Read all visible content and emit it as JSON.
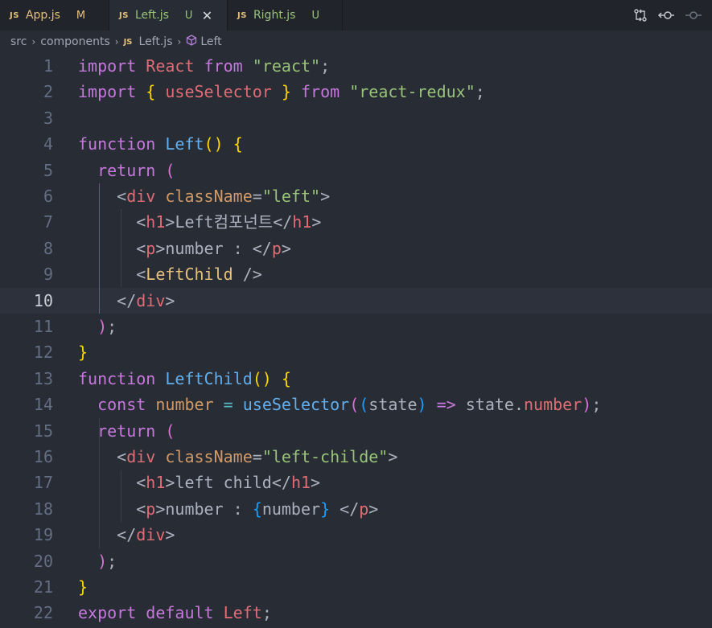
{
  "tabs": [
    {
      "icon": "JS",
      "name": "App.js",
      "status": "M"
    },
    {
      "icon": "JS",
      "name": "Left.js",
      "status": "U",
      "close": "✕"
    },
    {
      "icon": "JS",
      "name": "Right.js",
      "status": "U"
    }
  ],
  "breadcrumb": {
    "src": "src",
    "components": "components",
    "file_icon": "JS",
    "file": "Left.js",
    "symbol": "Left",
    "sep": "›"
  },
  "editor": {
    "current_line": 10,
    "line_numbers": [
      "1",
      "2",
      "3",
      "4",
      "5",
      "6",
      "7",
      "8",
      "9",
      "10",
      "11",
      "12",
      "13",
      "14",
      "15",
      "16",
      "17",
      "18",
      "19",
      "20",
      "21",
      "22"
    ],
    "lines": [
      [
        [
          "kw",
          "import"
        ],
        [
          "txt",
          " "
        ],
        [
          "id",
          "React"
        ],
        [
          "txt",
          " "
        ],
        [
          "kw",
          "from"
        ],
        [
          "txt",
          " "
        ],
        [
          "str",
          "\"react\""
        ],
        [
          "pun",
          ";"
        ]
      ],
      [
        [
          "kw",
          "import"
        ],
        [
          "txt",
          " "
        ],
        [
          "br1",
          "{"
        ],
        [
          "txt",
          " "
        ],
        [
          "id",
          "useSelector"
        ],
        [
          "txt",
          " "
        ],
        [
          "br1",
          "}"
        ],
        [
          "txt",
          " "
        ],
        [
          "kw",
          "from"
        ],
        [
          "txt",
          " "
        ],
        [
          "str",
          "\"react-redux\""
        ],
        [
          "pun",
          ";"
        ]
      ],
      [],
      [
        [
          "kw",
          "function"
        ],
        [
          "txt",
          " "
        ],
        [
          "fn",
          "Left"
        ],
        [
          "br1",
          "()"
        ],
        [
          "txt",
          " "
        ],
        [
          "br1",
          "{"
        ]
      ],
      [
        [
          "txt",
          "  "
        ],
        [
          "kw",
          "return"
        ],
        [
          "txt",
          " "
        ],
        [
          "br2",
          "("
        ]
      ],
      [
        [
          "txt",
          "    "
        ],
        [
          "pun",
          "<"
        ],
        [
          "tag",
          "div"
        ],
        [
          "txt",
          " "
        ],
        [
          "attr",
          "className"
        ],
        [
          "pun",
          "="
        ],
        [
          "str",
          "\"left\""
        ],
        [
          "pun",
          ">"
        ]
      ],
      [
        [
          "txt",
          "      "
        ],
        [
          "pun",
          "<"
        ],
        [
          "tag",
          "h1"
        ],
        [
          "pun",
          ">"
        ],
        [
          "txt",
          "Left컴포넌트"
        ],
        [
          "pun",
          "</"
        ],
        [
          "tag",
          "h1"
        ],
        [
          "pun",
          ">"
        ]
      ],
      [
        [
          "txt",
          "      "
        ],
        [
          "pun",
          "<"
        ],
        [
          "tag",
          "p"
        ],
        [
          "pun",
          ">"
        ],
        [
          "txt",
          "number : "
        ],
        [
          "pun",
          "</"
        ],
        [
          "tag",
          "p"
        ],
        [
          "pun",
          ">"
        ]
      ],
      [
        [
          "txt",
          "      "
        ],
        [
          "pun",
          "<"
        ],
        [
          "comp",
          "LeftChild"
        ],
        [
          "txt",
          " "
        ],
        [
          "pun",
          "/>"
        ]
      ],
      [
        [
          "txt",
          "    "
        ],
        [
          "pun",
          "</"
        ],
        [
          "tag",
          "div"
        ],
        [
          "pun",
          ">"
        ]
      ],
      [
        [
          "txt",
          "  "
        ],
        [
          "br2",
          ")"
        ],
        [
          "pun",
          ";"
        ]
      ],
      [
        [
          "br1",
          "}"
        ]
      ],
      [
        [
          "kw",
          "function"
        ],
        [
          "txt",
          " "
        ],
        [
          "fn",
          "LeftChild"
        ],
        [
          "br1",
          "()"
        ],
        [
          "txt",
          " "
        ],
        [
          "br1",
          "{"
        ]
      ],
      [
        [
          "txt",
          "  "
        ],
        [
          "kw",
          "const"
        ],
        [
          "txt",
          " "
        ],
        [
          "cst",
          "number"
        ],
        [
          "txt",
          " "
        ],
        [
          "op",
          "="
        ],
        [
          "txt",
          " "
        ],
        [
          "fn",
          "useSelector"
        ],
        [
          "br2",
          "("
        ],
        [
          "br3",
          "("
        ],
        [
          "txt",
          "state"
        ],
        [
          "br3",
          ")"
        ],
        [
          "txt",
          " "
        ],
        [
          "kw",
          "=>"
        ],
        [
          "txt",
          " "
        ],
        [
          "txt",
          "state"
        ],
        [
          "pun",
          "."
        ],
        [
          "prop",
          "number"
        ],
        [
          "br2",
          ")"
        ],
        [
          "pun",
          ";"
        ]
      ],
      [
        [
          "txt",
          "  "
        ],
        [
          "kw",
          "return"
        ],
        [
          "txt",
          " "
        ],
        [
          "br2",
          "("
        ]
      ],
      [
        [
          "txt",
          "    "
        ],
        [
          "pun",
          "<"
        ],
        [
          "tag",
          "div"
        ],
        [
          "txt",
          " "
        ],
        [
          "attr",
          "className"
        ],
        [
          "pun",
          "="
        ],
        [
          "str",
          "\"left-childe\""
        ],
        [
          "pun",
          ">"
        ]
      ],
      [
        [
          "txt",
          "      "
        ],
        [
          "pun",
          "<"
        ],
        [
          "tag",
          "h1"
        ],
        [
          "pun",
          ">"
        ],
        [
          "txt",
          "left child"
        ],
        [
          "pun",
          "</"
        ],
        [
          "tag",
          "h1"
        ],
        [
          "pun",
          ">"
        ]
      ],
      [
        [
          "txt",
          "      "
        ],
        [
          "pun",
          "<"
        ],
        [
          "tag",
          "p"
        ],
        [
          "pun",
          ">"
        ],
        [
          "txt",
          "number : "
        ],
        [
          "br3",
          "{"
        ],
        [
          "txt",
          "number"
        ],
        [
          "br3",
          "}"
        ],
        [
          "txt",
          " "
        ],
        [
          "pun",
          "</"
        ],
        [
          "tag",
          "p"
        ],
        [
          "pun",
          ">"
        ]
      ],
      [
        [
          "txt",
          "    "
        ],
        [
          "pun",
          "</"
        ],
        [
          "tag",
          "div"
        ],
        [
          "pun",
          ">"
        ]
      ],
      [
        [
          "txt",
          "  "
        ],
        [
          "br2",
          ")"
        ],
        [
          "pun",
          ";"
        ]
      ],
      [
        [
          "br1",
          "}"
        ]
      ],
      [
        [
          "kw",
          "export"
        ],
        [
          "txt",
          " "
        ],
        [
          "kw",
          "default"
        ],
        [
          "txt",
          " "
        ],
        [
          "id",
          "Left"
        ],
        [
          "pun",
          ";"
        ]
      ]
    ]
  }
}
